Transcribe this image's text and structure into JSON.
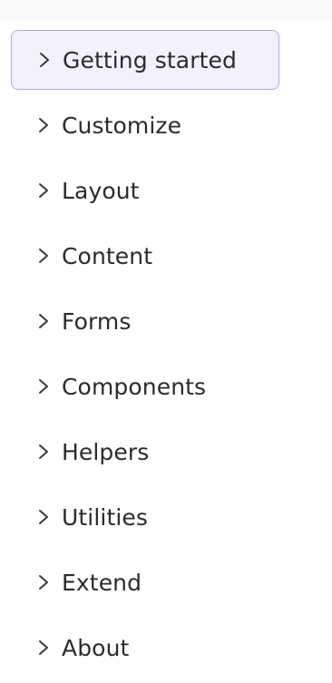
{
  "sidebar": {
    "items": [
      {
        "label": "Getting started",
        "icon": "chevron-right-icon",
        "active": true
      },
      {
        "label": "Customize",
        "icon": "chevron-right-icon",
        "active": false
      },
      {
        "label": "Layout",
        "icon": "chevron-right-icon",
        "active": false
      },
      {
        "label": "Content",
        "icon": "chevron-right-icon",
        "active": false
      },
      {
        "label": "Forms",
        "icon": "chevron-right-icon",
        "active": false
      },
      {
        "label": "Components",
        "icon": "chevron-right-icon",
        "active": false
      },
      {
        "label": "Helpers",
        "icon": "chevron-right-icon",
        "active": false
      },
      {
        "label": "Utilities",
        "icon": "chevron-right-icon",
        "active": false
      },
      {
        "label": "Extend",
        "icon": "chevron-right-icon",
        "active": false
      },
      {
        "label": "About",
        "icon": "chevron-right-icon",
        "active": false
      }
    ]
  },
  "colors": {
    "active_border": "#b8a6ea",
    "active_background": "#f4f0fd",
    "text": "#2b2b2b"
  }
}
